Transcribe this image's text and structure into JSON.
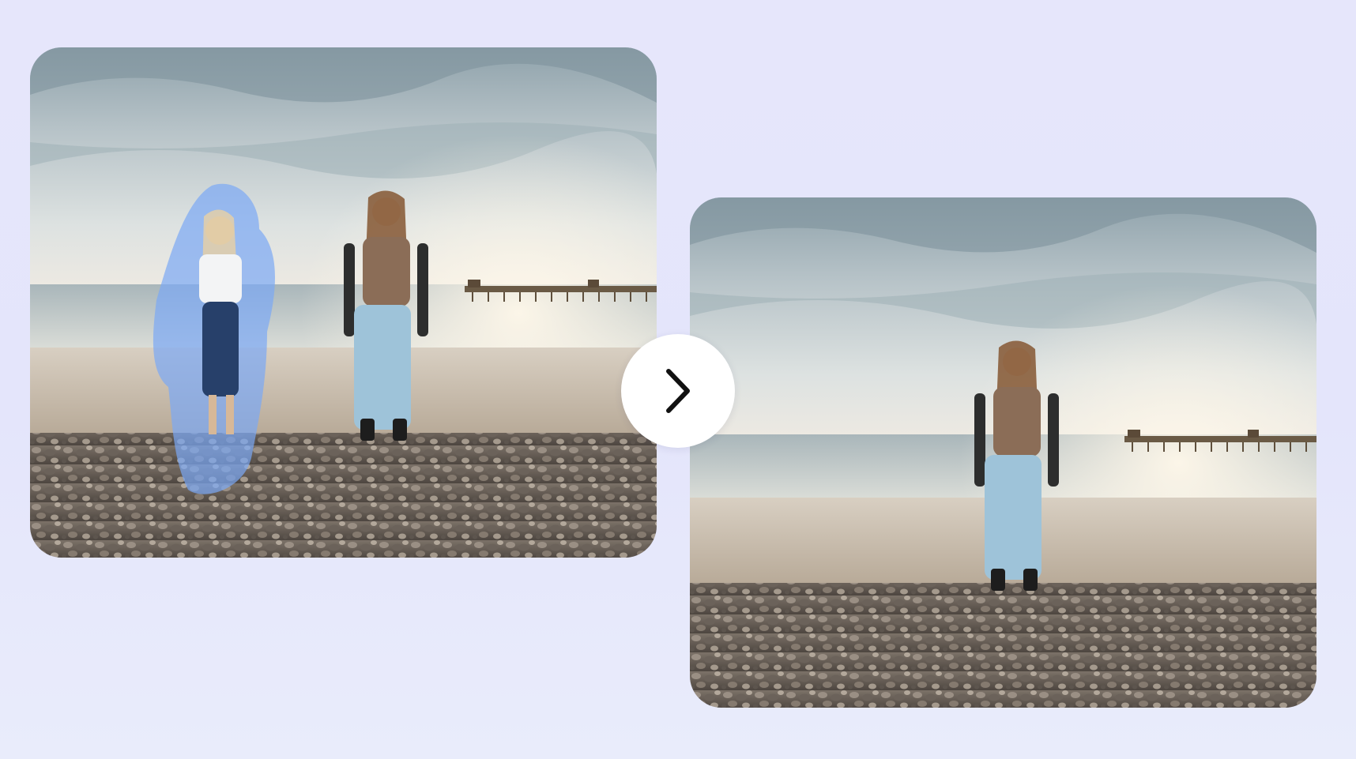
{
  "before_photo": {
    "icon": "beach-photo-with-selection-mask",
    "mask_color": "#7aa8f5"
  },
  "after_photo": {
    "icon": "beach-photo-person-removed"
  },
  "next_button": {
    "icon": "chevron-right-icon"
  },
  "colors": {
    "background": "#e6e6fb",
    "mask": "#7aa8f5",
    "button": "#ffffff",
    "chevron": "#111111"
  }
}
